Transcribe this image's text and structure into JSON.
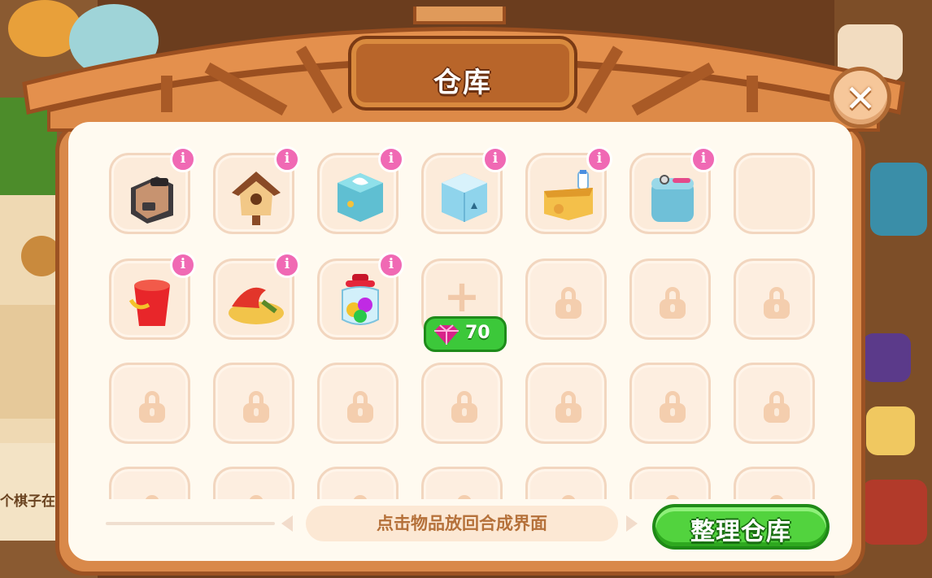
{
  "window": {
    "title": "仓库",
    "close_icon": "close-icon"
  },
  "background": {
    "partial_text": "个棋子在"
  },
  "grid": {
    "rows": [
      [
        {
          "item": "toaster-icon",
          "info": "i"
        },
        {
          "item": "birdhouse-icon",
          "info": "i"
        },
        {
          "item": "tissue-box-icon",
          "info": "i"
        },
        {
          "item": "ice-cube-box-icon",
          "info": "i"
        },
        {
          "item": "milk-crate-icon",
          "info": "i"
        },
        {
          "item": "sewing-box-icon",
          "info": "i"
        },
        {
          "item": "empty"
        }
      ],
      [
        {
          "item": "red-bucket-icon",
          "info": "i"
        },
        {
          "item": "sand-pile-icon",
          "info": "i"
        },
        {
          "item": "candy-jar-icon",
          "info": "i"
        },
        {
          "item": "unlock-slot",
          "plus": "+",
          "price": "70",
          "currency_icon": "gem-icon"
        },
        {
          "item": "locked"
        },
        {
          "item": "locked"
        },
        {
          "item": "locked"
        }
      ],
      [
        {
          "item": "locked"
        },
        {
          "item": "locked"
        },
        {
          "item": "locked"
        },
        {
          "item": "locked"
        },
        {
          "item": "locked"
        },
        {
          "item": "locked"
        },
        {
          "item": "locked"
        }
      ],
      [
        {
          "item": "locked"
        },
        {
          "item": "locked"
        },
        {
          "item": "locked"
        },
        {
          "item": "locked"
        },
        {
          "item": "locked"
        },
        {
          "item": "locked"
        },
        {
          "item": "locked"
        }
      ]
    ]
  },
  "footer": {
    "hint": "点击物品放回合成界面",
    "organize_label": "整理仓库"
  },
  "colors": {
    "info_badge": "#f069b4",
    "price_green": "#3cc83a",
    "frame_brown": "#d9894a",
    "panel_cream": "#fffaf0"
  }
}
